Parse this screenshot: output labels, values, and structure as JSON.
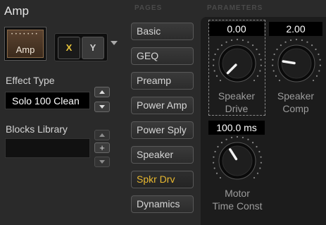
{
  "block": {
    "title": "Amp",
    "tile_label": "Amp",
    "tile_icon": "amp-cabinet-icon",
    "x_label": "X",
    "y_label": "Y"
  },
  "effect_type": {
    "label": "Effect Type",
    "value": "Solo 100 Clean"
  },
  "blocks_library": {
    "label": "Blocks Library",
    "value": "",
    "plus_label": "+"
  },
  "headers": {
    "pages": "PAGES",
    "parameters": "PARAMETERS"
  },
  "pages": [
    {
      "label": "Basic",
      "active": false
    },
    {
      "label": "GEQ",
      "active": false
    },
    {
      "label": "Preamp",
      "active": false
    },
    {
      "label": "Power Amp",
      "active": false
    },
    {
      "label": "Power Sply",
      "active": false
    },
    {
      "label": "Speaker",
      "active": false
    },
    {
      "label": "Spkr Drv",
      "active": true
    },
    {
      "label": "Dynamics",
      "active": false
    }
  ],
  "parameters": [
    {
      "value": "0.00",
      "label_line1": "Speaker",
      "label_line2": "Drive",
      "level": 0.0
    },
    {
      "value": "2.00",
      "label_line1": "Speaker",
      "label_line2": "Comp",
      "level": 0.2
    },
    {
      "value": "100.0 ms",
      "label_line1": "Motor",
      "label_line2": "Time Const",
      "level": 0.38
    }
  ],
  "colors": {
    "accent": "#e8b830",
    "background": "#2a2a2a",
    "panel": "#1c1c1c"
  }
}
